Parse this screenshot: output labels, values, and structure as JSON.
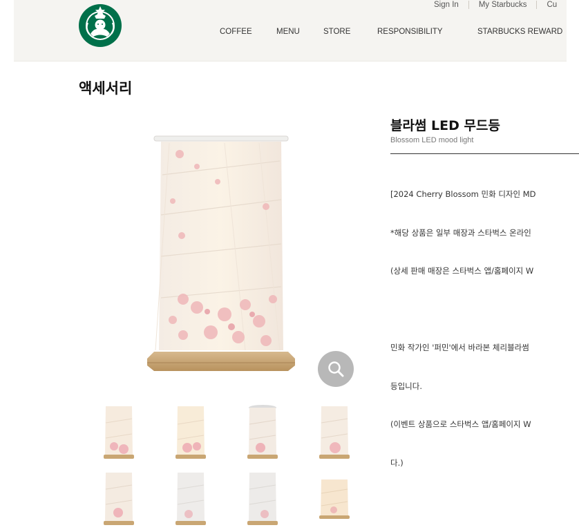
{
  "header": {
    "util_links": [
      "Sign In",
      "My Starbucks",
      "Cu"
    ],
    "nav": [
      "COFFEE",
      "MENU",
      "STORE",
      "RESPONSIBILITY",
      "STARBUCKS REWARD"
    ]
  },
  "page": {
    "title": "액세서리"
  },
  "product": {
    "name_ko": "블라썸 LED 무드등",
    "name_en": "Blossom LED mood light",
    "description_lines": [
      "[2024 Cherry Blossom 민화 디자인 MD",
      "*해당 상품은 일부 매장과 스타벅스 온라인",
      "(상세 판매 매장은 스타벅스 앱/홈페이지 W",
      "",
      "민화 작가인 '퍼민'에서 바라본 체리블라썸",
      "등입니다.",
      "(이벤트 상품으로 스타벅스 앱/홈페이지 W",
      "다.)"
    ]
  },
  "icons": {
    "zoom": "magnifier-icon",
    "logo": "starbucks-siren-logo"
  },
  "colors": {
    "brand_green": "#00704a",
    "header_bg": "#f5f4f1",
    "zoom_bg": "#b8b8b8"
  }
}
